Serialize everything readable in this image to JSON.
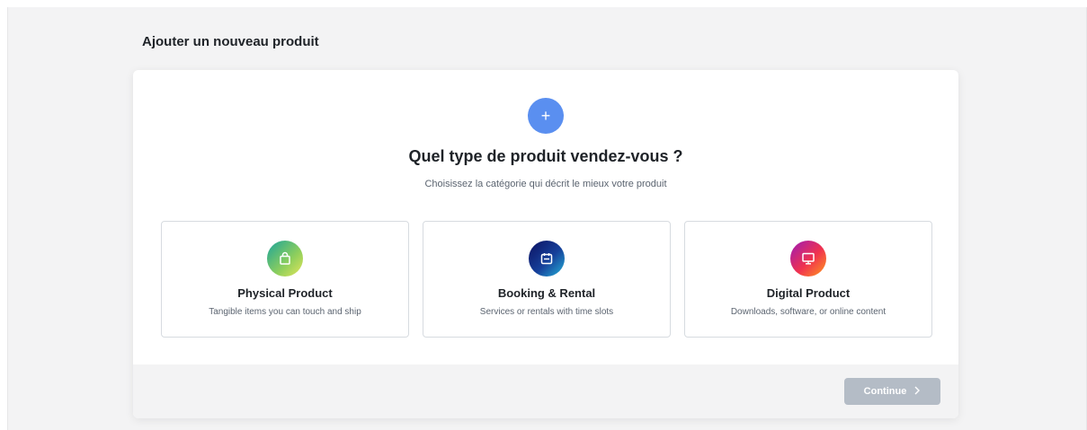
{
  "page": {
    "title": "Ajouter un nouveau produit"
  },
  "wizard": {
    "add_icon": "plus-icon",
    "add_symbol": "+",
    "question": "Quel type de produit vendez-vous ?",
    "subtitle": "Choisissez la catégorie qui décrit le mieux votre produit",
    "options": [
      {
        "title": "Physical Product",
        "description": "Tangible items you can touch and ship",
        "icon": "shopping-bag-icon",
        "gradient": [
          "#1aa39a",
          "#8fcf5c",
          "#e3e55a"
        ]
      },
      {
        "title": "Booking & Rental",
        "description": "Services or rentals with time slots",
        "icon": "calendar-icon",
        "gradient": [
          "#0c1060",
          "#16409a",
          "#25b2d9"
        ]
      },
      {
        "title": "Digital Product",
        "description": "Downloads, software, or online content",
        "icon": "monitor-icon",
        "gradient": [
          "#9c1bb8",
          "#f0324f",
          "#ff9a1d"
        ]
      }
    ]
  },
  "footer": {
    "continue_label": "Continue",
    "continue_icon": "chevron-right-icon",
    "continue_state": "disabled"
  },
  "colors": {
    "accent": "#5a8ff0",
    "disabled_button": "#b4bcc6",
    "background": "#f3f3f4"
  }
}
